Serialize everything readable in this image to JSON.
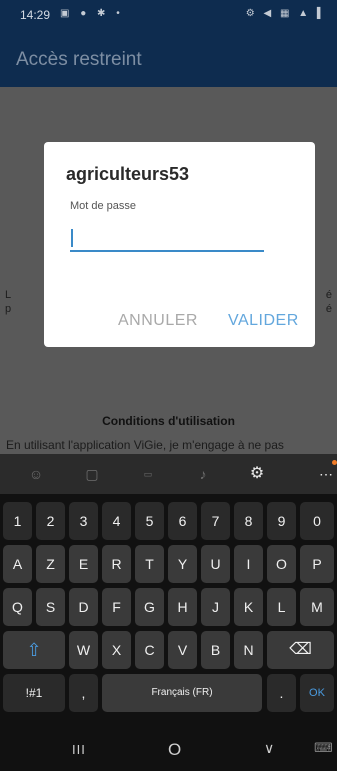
{
  "status_bar": {
    "time": "14:29",
    "left_icons": "▣ ● ✱ •",
    "right_icons": "⚙ ◀ ▦ ▲ ▌"
  },
  "app_bar": {
    "title": "Accès restreint"
  },
  "background": {
    "left_fragment_1": "L",
    "left_fragment_2": "p",
    "right_fragment_1": "é",
    "right_fragment_2": "é",
    "conditions_title": "Conditions d'utilisation",
    "conditions_text": "En utilisant l'application ViGie, je m'engage à ne pas"
  },
  "dialog": {
    "title": "agriculteurs53",
    "label": "Mot de passe",
    "password_value": "",
    "cancel_label": "ANNULER",
    "validate_label": "VALIDER"
  },
  "keyboard": {
    "toolbar_icons": [
      "emoji-icon",
      "sticker-icon",
      "gif-icon",
      "mic-icon",
      "settings-icon",
      "more-icon"
    ],
    "row_numbers": [
      "1",
      "2",
      "3",
      "4",
      "5",
      "6",
      "7",
      "8",
      "9",
      "0"
    ],
    "row_1": [
      "A",
      "Z",
      "E",
      "R",
      "T",
      "Y",
      "U",
      "I",
      "O",
      "P"
    ],
    "row_2": [
      "Q",
      "S",
      "D",
      "F",
      "G",
      "H",
      "J",
      "K",
      "L",
      "M"
    ],
    "row_3": [
      "W",
      "X",
      "C",
      "V",
      "B",
      "N"
    ],
    "shift_glyph": "⇧",
    "backspace_glyph": "⌫",
    "symbols_label": "!#1",
    "comma_label": ",",
    "space_label": "Français (FR)",
    "period_label": ".",
    "enter_label": "OK"
  },
  "nav_bar": {
    "recents_glyph": "III",
    "home_glyph": "O",
    "back_glyph": "∨",
    "keyboard_glyph": "⌨"
  },
  "colors": {
    "app_bar": "#0e2c4f",
    "accent": "#3a8ac8",
    "validate": "#63a7dd",
    "cancel": "#a9a9a9"
  }
}
